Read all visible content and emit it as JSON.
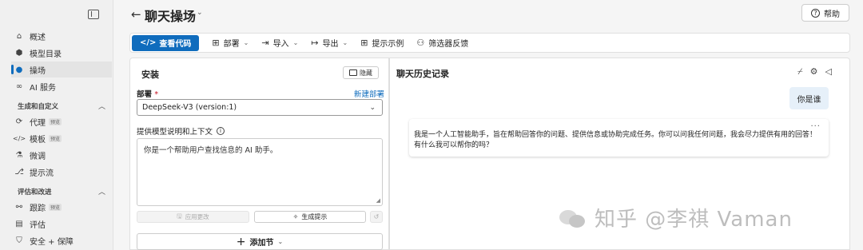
{
  "sidebar": {
    "items": [
      {
        "label": "概述",
        "icon": "home-icon",
        "glyph": "⌂"
      },
      {
        "label": "模型目录",
        "icon": "cube-icon",
        "glyph": "⬢"
      },
      {
        "label": "操场",
        "icon": "chat-icon",
        "glyph": "💬",
        "active": true
      },
      {
        "label": "AI 服务",
        "icon": "ai-services-icon",
        "glyph": "∞"
      }
    ],
    "section1": {
      "title": "生成和自定义",
      "items": [
        {
          "label": "代理",
          "icon": "agent-icon",
          "glyph": "⟳",
          "badge": "预览"
        },
        {
          "label": "模板",
          "icon": "code-icon",
          "glyph": "</>",
          "badge": "预览"
        },
        {
          "label": "微调",
          "icon": "flask-icon",
          "glyph": "⚗"
        },
        {
          "label": "提示流",
          "icon": "prompt-flow-icon",
          "glyph": "⎇"
        }
      ]
    },
    "section2": {
      "title": "评估和改进",
      "items": [
        {
          "label": "跟踪",
          "icon": "trace-icon",
          "glyph": "⚯",
          "badge": "预览"
        },
        {
          "label": "评估",
          "icon": "evaluate-icon",
          "glyph": "▤"
        },
        {
          "label": "安全 + 保障",
          "icon": "shield-icon",
          "glyph": "⛉"
        }
      ]
    }
  },
  "header": {
    "back": "←",
    "title": "聊天操场",
    "help": "帮助"
  },
  "toolbar": {
    "view_code": "查看代码",
    "deploy": "部署",
    "import": "导入",
    "export": "导出",
    "prompt_samples": "提示示例",
    "filter_feedback": "筛选器反馈"
  },
  "setup": {
    "title": "安装",
    "hide": "隐藏",
    "deployment_label": "部署",
    "required_mark": "*",
    "new_deployment": "新建部署",
    "deployment_value": "DeepSeek-V3 (version:1)",
    "context_label": "提供模型说明和上下文",
    "system_message": "你是一个帮助用户查找信息的 AI 助手。",
    "apply_changes": "应用更改",
    "generate_prompt": "生成提示",
    "add_section": "添加节"
  },
  "chat": {
    "title": "聊天历史记录",
    "user_message": "你是谁",
    "assistant_message": "我是一个人工智能助手，旨在帮助回答你的问题、提供信息或协助完成任务。你可以问我任何问题，我会尽力提供有用的回答！有什么我可以帮你的吗？",
    "more": "..."
  },
  "watermark": "知乎 @李祺 Vaman"
}
